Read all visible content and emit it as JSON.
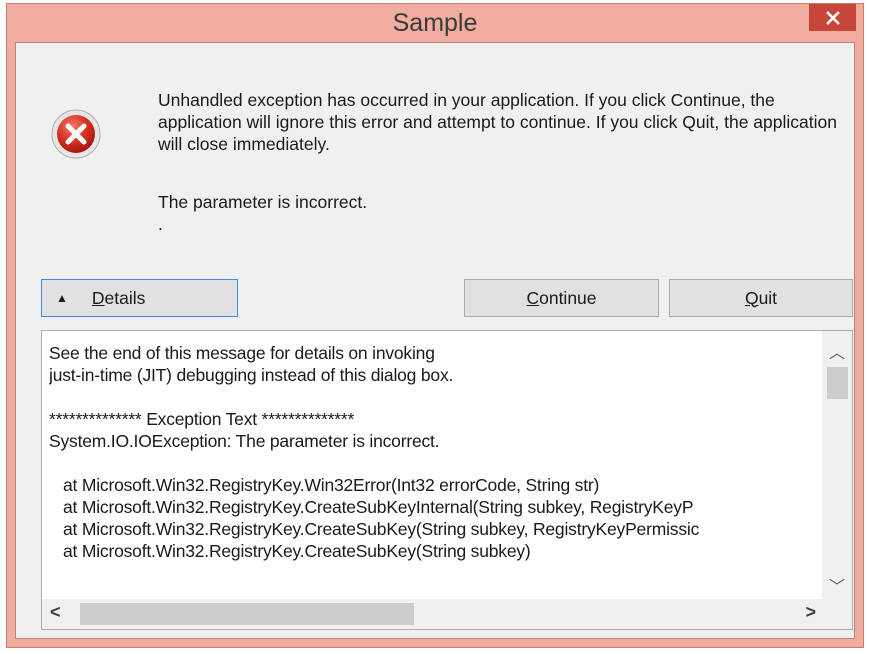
{
  "window": {
    "title": "Sample"
  },
  "message": {
    "text": "Unhandled exception has occurred in your application. If you click Continue, the application will ignore this error and attempt to continue. If you click Quit, the application will close immediately.",
    "error": "The parameter is incorrect.",
    "trailing": "."
  },
  "buttons": {
    "details": {
      "mnemonic": "D",
      "rest": "etails"
    },
    "continue": {
      "mnemonic": "C",
      "rest": "ontinue"
    },
    "quit": {
      "mnemonic": "Q",
      "rest": "uit"
    }
  },
  "details": {
    "text": "See the end of this message for details on invoking\njust-in-time (JIT) debugging instead of this dialog box.\n\n************** Exception Text **************\nSystem.IO.IOException: The parameter is incorrect.\n\n   at Microsoft.Win32.RegistryKey.Win32Error(Int32 errorCode, String str)\n   at Microsoft.Win32.RegistryKey.CreateSubKeyInternal(String subkey, RegistryKeyP\n   at Microsoft.Win32.RegistryKey.CreateSubKey(String subkey, RegistryKeyPermissic\n   at Microsoft.Win32.RegistryKey.CreateSubKey(String subkey)"
  },
  "icons": {
    "error": "error-icon",
    "close": "close-icon"
  },
  "colors": {
    "titlebar": "#f0ac9e",
    "close": "#c7463a",
    "focus": "#3d8ee0"
  }
}
